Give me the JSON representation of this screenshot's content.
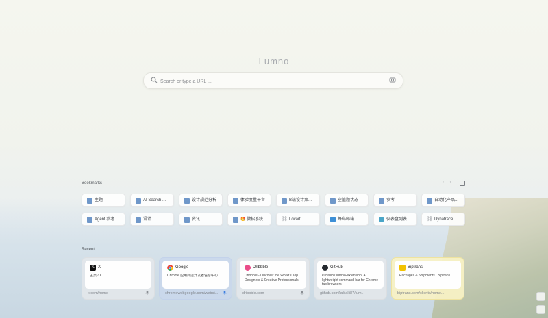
{
  "brand": "Lumno",
  "search": {
    "placeholder": "Search or type a URL ..."
  },
  "bookmarks": {
    "label": "Bookmarks",
    "prev": "‹",
    "next": "›",
    "row1": [
      {
        "label": "主题",
        "icon": "folder-icon"
      },
      {
        "label": "AI Search ...",
        "icon": "folder-icon"
      },
      {
        "label": "设计规范分析",
        "icon": "folder-icon"
      },
      {
        "label": "体验度量平台",
        "icon": "folder-icon"
      },
      {
        "label": "B端设计案...",
        "icon": "folder-icon"
      },
      {
        "label": "空值题状态",
        "icon": "folder-icon"
      },
      {
        "label": "参考",
        "icon": "folder-icon"
      },
      {
        "label": "自动化产品...",
        "icon": "folder-icon"
      }
    ],
    "row2": [
      {
        "label": "Agent 参考",
        "icon": "folder-icon"
      },
      {
        "label": "设计",
        "icon": "folder-icon"
      },
      {
        "label": "资讯",
        "icon": "folder-icon"
      },
      {
        "label": "🤩 微招系统",
        "icon": "folder-icon"
      },
      {
        "label": "Lovart",
        "icon": "link-icon"
      },
      {
        "label": "蜂鸟邮箱",
        "icon": "bird-icon"
      },
      {
        "label": "仪表盘列表",
        "icon": "cloud-icon"
      },
      {
        "label": "Dynatrace",
        "icon": "link-icon"
      }
    ]
  },
  "recent": {
    "label": "Recent",
    "cards": [
      {
        "title": "X",
        "desc": "主页 / X",
        "url": "x.com/home",
        "icon_color": "#111111",
        "glyph": "𝕏"
      },
      {
        "title": "Google",
        "desc": "Chrome 应用商店开发者信息中心",
        "url": "chromewebgoogle.com/webst...",
        "icon_color": "#ea4335",
        "glyph": "G"
      },
      {
        "title": "Dribbble",
        "desc": "Dribbble - Discover the World's Top Designers & Creative Professionals",
        "url": "dribbble.com",
        "icon_color": "#ea4c89",
        "glyph": "◎"
      },
      {
        "title": "GitHub",
        "desc": "kuballi87/lumno-extension: A lightweight command bar for Chrome tab browsers",
        "url": "github.com/kuballi87/lum...",
        "icon_color": "#24292f",
        "glyph": "●"
      },
      {
        "title": "Biptrans",
        "desc": "Packages & Shipments | Biptrans",
        "url": "biptrans.com/clients/home...",
        "icon_color": "#f2c200",
        "glyph": "B"
      }
    ]
  },
  "colors": {
    "accent": "#6f97c9",
    "active_card": "#c9d7ec",
    "highlight_card": "#f9f2c4"
  }
}
